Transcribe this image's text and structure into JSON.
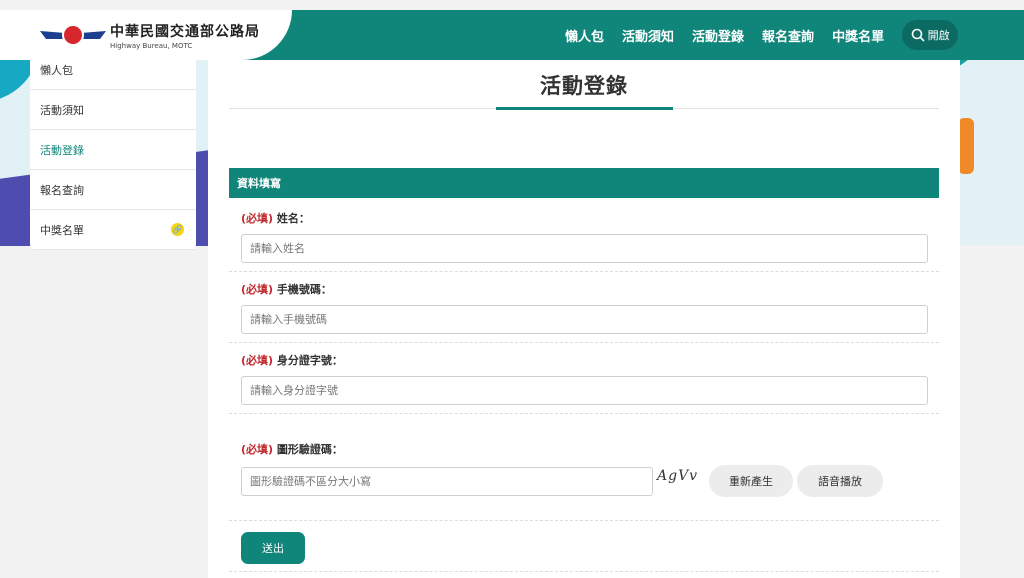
{
  "header": {
    "logo_title": "中華民國交通部公路局",
    "logo_subtitle": "Highway Bureau, MOTC",
    "nav_items": [
      "懶人包",
      "活動須知",
      "活動登錄",
      "報名查詢",
      "中獎名單"
    ],
    "search_label": "開啟"
  },
  "sidebar": {
    "items": [
      {
        "label": "懶人包"
      },
      {
        "label": "活動須知"
      },
      {
        "label": "活動登錄"
      },
      {
        "label": "報名查詢"
      },
      {
        "label": "中獎名單"
      }
    ],
    "active_item": "活動登錄",
    "external_link_icon": "link-icon"
  },
  "main": {
    "title": "活動登錄",
    "section_title": "資料填寫",
    "required_tag": "(必填)",
    "fields": {
      "name": {
        "label": "姓名：",
        "placeholder": "請輸入姓名",
        "value": ""
      },
      "phone": {
        "label": "手機號碼：",
        "placeholder": "請輸入手機號碼",
        "value": ""
      },
      "id": {
        "label": "身分證字號：",
        "placeholder": "請輸入身分證字號",
        "value": ""
      },
      "captcha": {
        "label": "圖形驗證碼：",
        "placeholder": "圖形驗證碼不區分大小寫",
        "value": ""
      }
    },
    "captcha_text": "AgVv",
    "regenerate_label": "重新產生",
    "audio_label": "語音播放",
    "submit_label": "送出"
  },
  "colors": {
    "brand": "#10857a",
    "required": "#c0282e",
    "logo_red": "#d8262f",
    "logo_blue": "#1c3f8f"
  }
}
